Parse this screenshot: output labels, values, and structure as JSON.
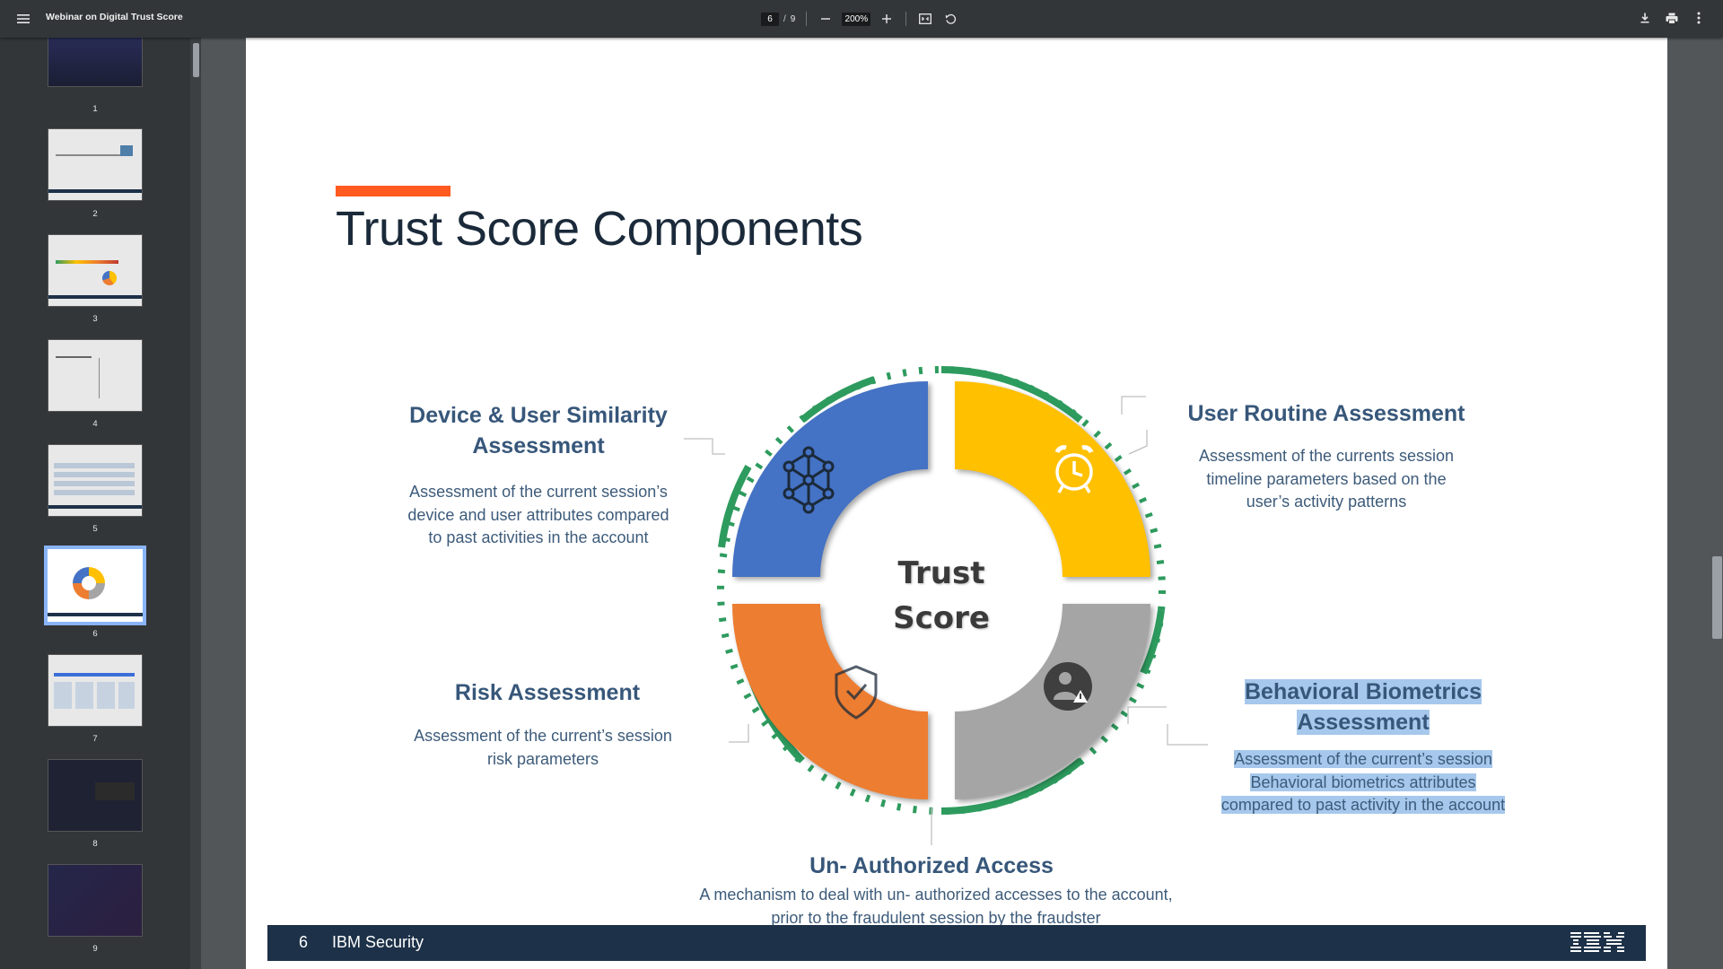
{
  "toolbar": {
    "title": "Webinar on Digital Trust Score",
    "page_current": "6",
    "page_total": "9",
    "zoom": "200%"
  },
  "thumbnails": [
    {
      "label": "1"
    },
    {
      "label": "2"
    },
    {
      "label": "3"
    },
    {
      "label": "4"
    },
    {
      "label": "5"
    },
    {
      "label": "6"
    },
    {
      "label": "7"
    },
    {
      "label": "8"
    },
    {
      "label": "9"
    }
  ],
  "slide": {
    "title": "Trust Score Components",
    "center_line1": "Trust",
    "center_line2": "Score",
    "device": {
      "title1": "Device & User Similarity",
      "title2": "Assessment",
      "desc1": "Assessment of the current session’s",
      "desc2": "device  and user attributes compared",
      "desc3": "to past activities in the account"
    },
    "routine": {
      "title": "User Routine Assessment",
      "desc1": "Assessment of the currents session",
      "desc2": "timeline parameters based on the",
      "desc3": "user’s activity patterns"
    },
    "risk": {
      "title": "Risk Assessment",
      "desc1": "Assessment of the current’s session",
      "desc2": "risk parameters"
    },
    "behavioral": {
      "title1": "Behavioral Biometrics",
      "title2": "Assessment",
      "desc1": "Assessment of the current’s session",
      "desc2": "Behavioral biometrics attributes",
      "desc3": "compared to past activity in the account"
    },
    "unauth": {
      "title": "Un- Authorized Access",
      "desc1": "A mechanism to deal with un- authorized accesses to the account,",
      "desc2": "prior to the fraudulent session by the fraudster"
    },
    "footer_page": "6",
    "footer_brand": "IBM Security",
    "colors": {
      "accent": "#ff5a1f",
      "blue": "#4472c4",
      "yellow": "#ffc000",
      "orange": "#ed7d31",
      "gray": "#a5a5a5",
      "green": "#2e9b5e",
      "navy": "#1d3148"
    }
  }
}
